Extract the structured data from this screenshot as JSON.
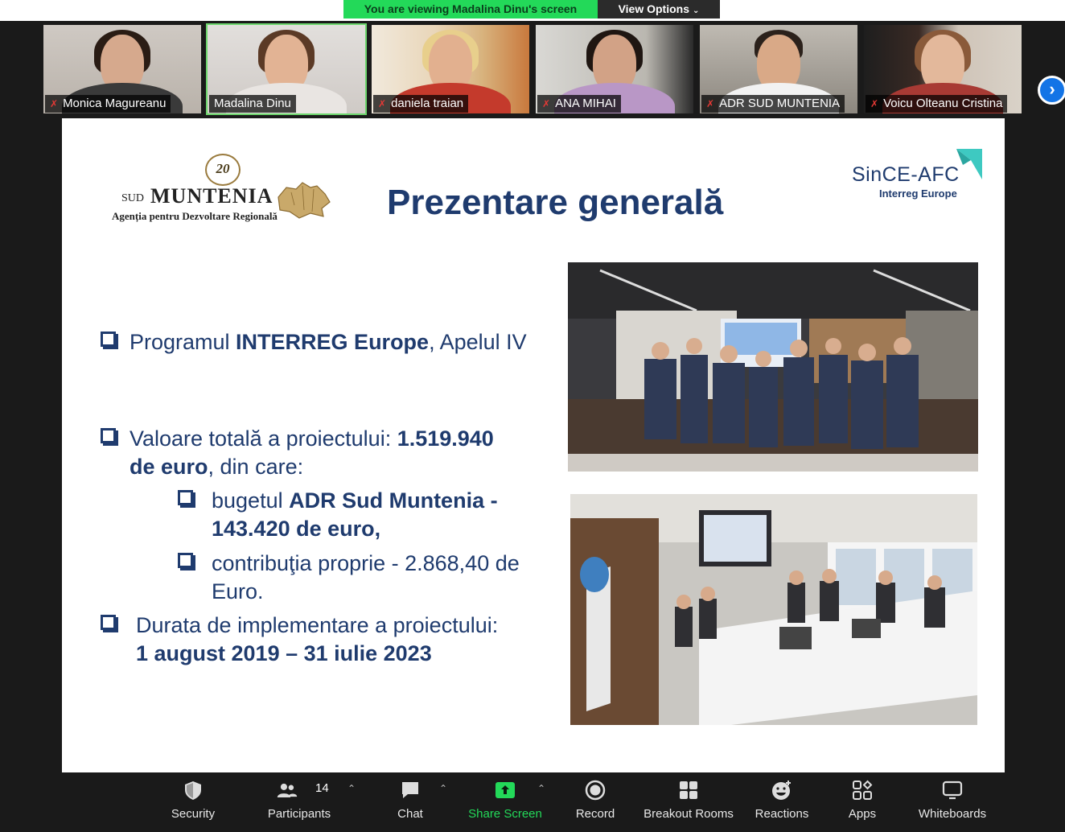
{
  "banner": {
    "viewing_text": "You are viewing Madalina Dinu's screen",
    "view_options_label": "View Options"
  },
  "participants": [
    {
      "name": "Monica Magureanu",
      "muted": true
    },
    {
      "name": "Madalina Dinu",
      "muted": false,
      "active_speaker": true
    },
    {
      "name": "daniela traian",
      "muted": true
    },
    {
      "name": "ANA MIHAI",
      "muted": true
    },
    {
      "name": "ADR SUD MUNTENIA",
      "muted": true
    },
    {
      "name": "Voicu Olteanu Cristina",
      "muted": true
    }
  ],
  "slide": {
    "logo_left": {
      "anniversary": "20",
      "sud": "SUD",
      "muntenia": "MUNTENIA",
      "agency": "Agenția pentru Dezvoltare Regională"
    },
    "title": "Prezentare generală",
    "logo_right": {
      "name": "SinCE-AFC",
      "subtitle": "Interreg Europe"
    },
    "bullets": {
      "b1_pre": "Programul ",
      "b1_bold": "INTERREG Europe",
      "b1_post": ", Apelul IV",
      "b2_pre": "Valoare totală a proiectului: ",
      "b2_bold1": "1.519.940",
      "b2_bold2": "de euro",
      "b2_post": ", din care:",
      "b3_pre": " bugetul ",
      "b3_bold": "ADR Sud Muntenia - 143.420 de euro,",
      "b4_text": " contribuţia proprie -  2.868,40 de Euro.",
      "b5_pre": "Durata de implementare a proiectului:",
      "b5_bold": "1 august 2019 – 31 iulie 2023"
    }
  },
  "toolbar": {
    "security": "Security",
    "participants": "Participants",
    "participants_count": "14",
    "chat": "Chat",
    "share_screen": "Share Screen",
    "record": "Record",
    "breakout_rooms": "Breakout Rooms",
    "reactions": "Reactions",
    "apps": "Apps",
    "whiteboards": "Whiteboards"
  },
  "colors": {
    "banner_green": "#23d959",
    "slide_blue": "#1f3b6e",
    "share_green": "#23d959",
    "next_blue": "#1374e6"
  }
}
